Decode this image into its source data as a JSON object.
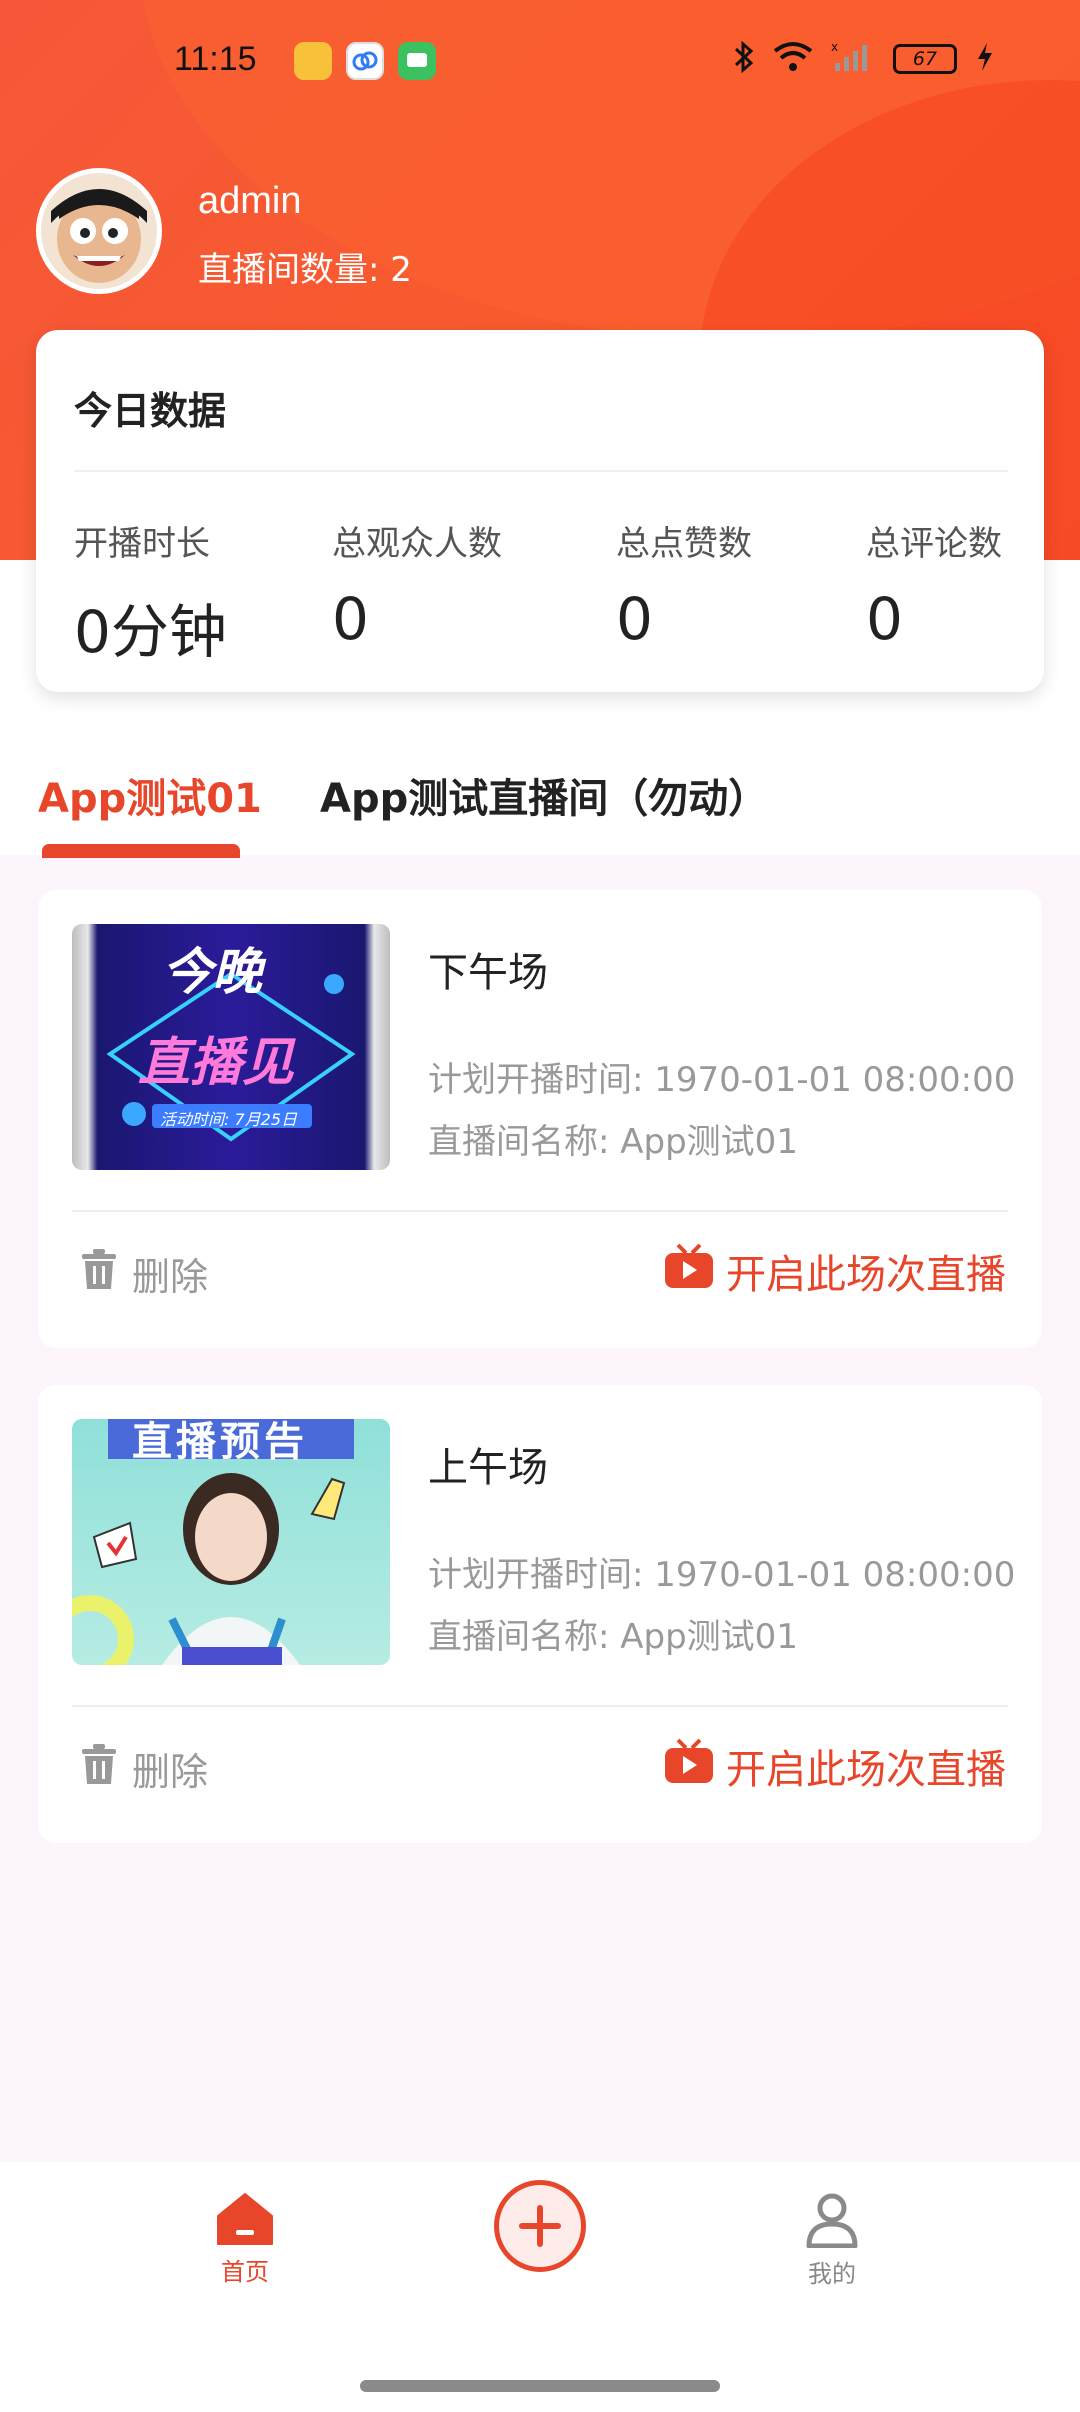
{
  "status_bar": {
    "time": "11:15",
    "battery": "67"
  },
  "profile": {
    "username": "admin",
    "room_count": "直播间数量: 2"
  },
  "stats": {
    "title": "今日数据",
    "items": [
      {
        "label": "开播时长",
        "value": "0分钟"
      },
      {
        "label": "总观众人数",
        "value": "0"
      },
      {
        "label": "总点赞数",
        "value": "0"
      },
      {
        "label": "总评论数",
        "value": "0"
      }
    ]
  },
  "tabs": [
    {
      "label": "App测试01",
      "active": true
    },
    {
      "label": "App测试直播间（勿动）",
      "active": false
    }
  ],
  "sessions": [
    {
      "title": "下午场",
      "planned_time": "计划开播时间: 1970-01-01 08:00:00",
      "room_name": "直播间名称: App测试01",
      "delete_label": "删除",
      "start_label": "开启此场次直播",
      "thumb_text_1": "今晚",
      "thumb_text_2": "直播见",
      "thumb_text_3": "活动时间: 7月25日"
    },
    {
      "title": "上午场",
      "planned_time": "计划开播时间: 1970-01-01 08:00:00",
      "room_name": "直播间名称: App测试01",
      "delete_label": "删除",
      "start_label": "开启此场次直播",
      "thumb_text_1": "直播预告"
    }
  ],
  "bottom_nav": {
    "home_label": "首页",
    "mine_label": "我的"
  },
  "colors": {
    "accent": "#e8462b",
    "header": "#f6573a"
  }
}
